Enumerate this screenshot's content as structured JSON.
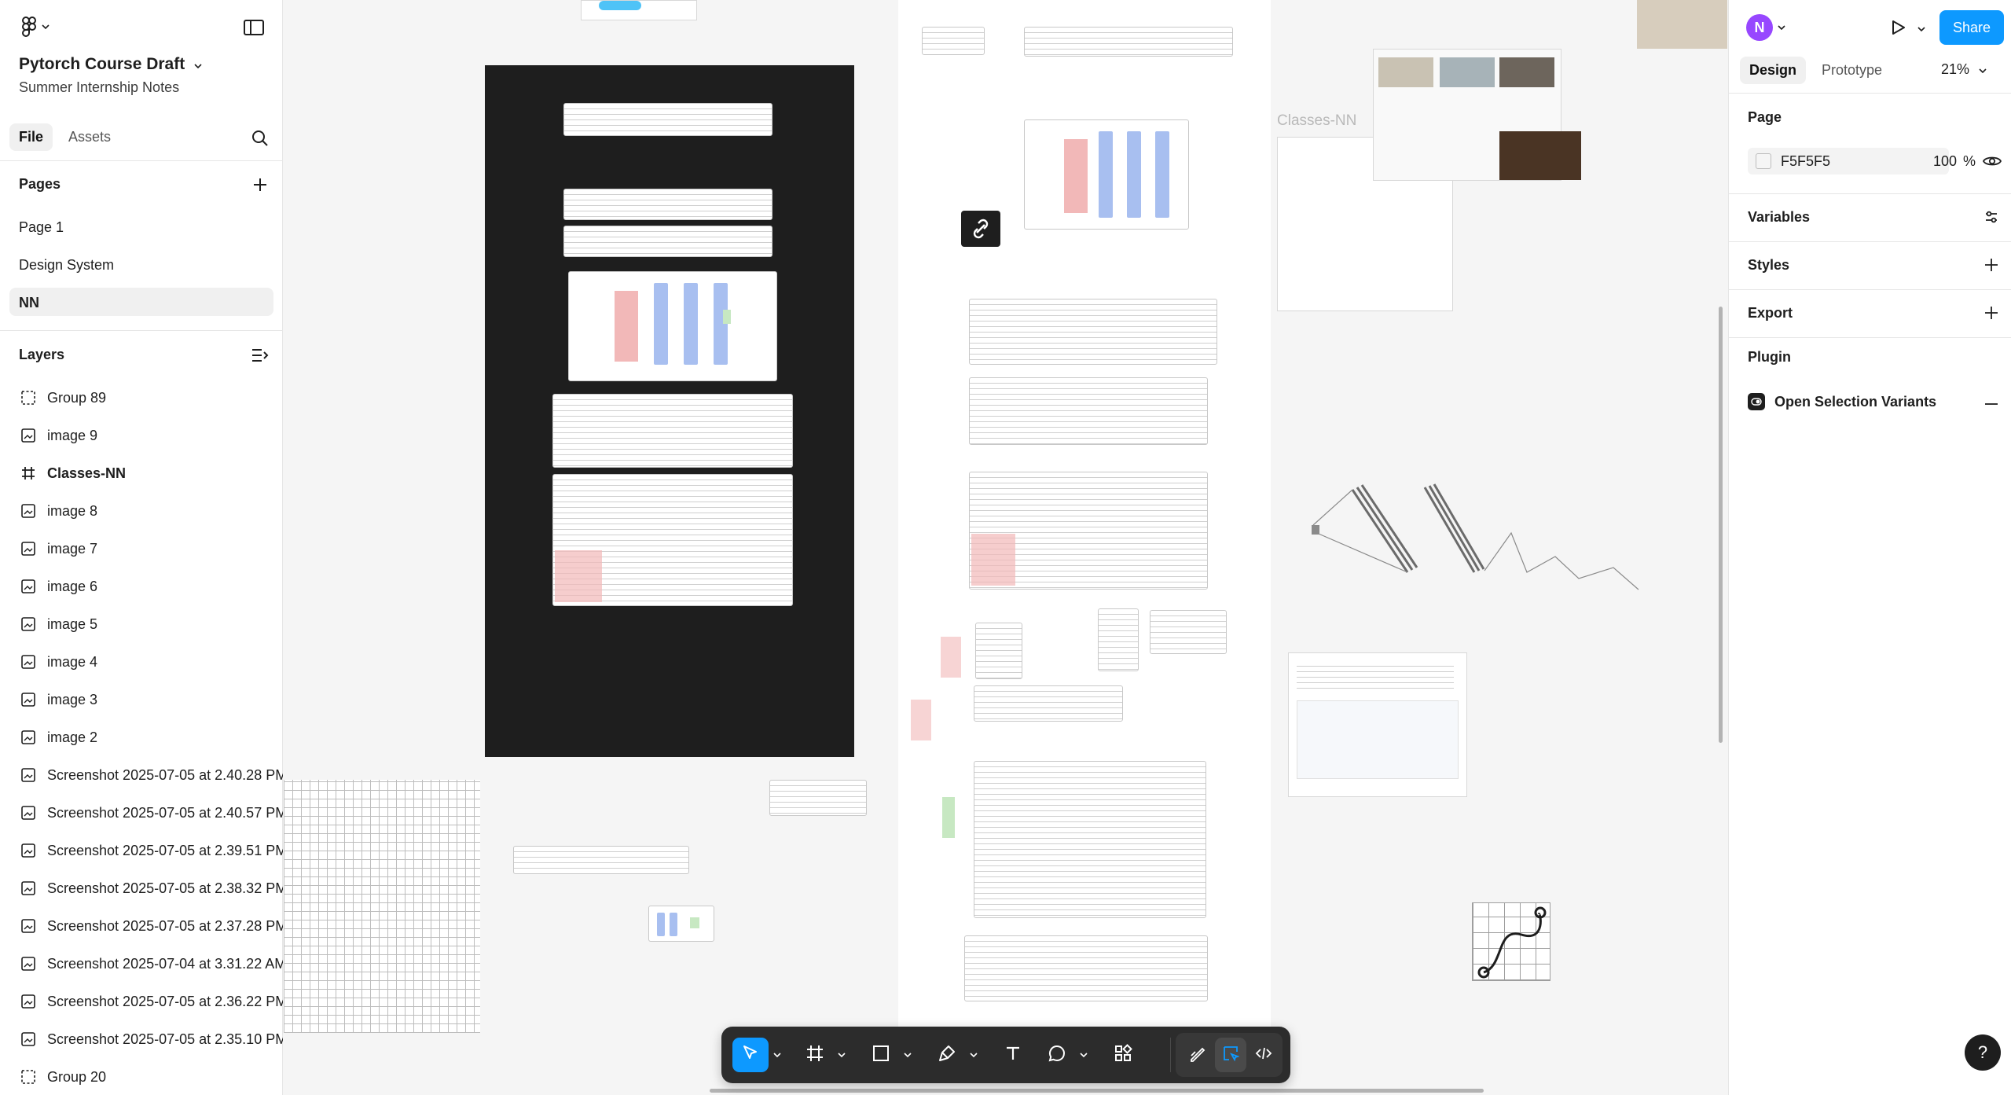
{
  "app": {
    "file_title": "Pytorch Course Draft",
    "file_subtitle": "Summer Internship Notes"
  },
  "left_panel": {
    "tabs": [
      {
        "label": "File",
        "active": true
      },
      {
        "label": "Assets",
        "active": false
      }
    ],
    "pages_heading": "Pages",
    "pages": [
      {
        "label": "Page 1",
        "active": false
      },
      {
        "label": "Design System",
        "active": false
      },
      {
        "label": "NN",
        "active": true
      }
    ],
    "layers_heading": "Layers",
    "layers": [
      {
        "label": "Group 89",
        "icon": "group-icon"
      },
      {
        "label": "image 9",
        "icon": "image-icon"
      },
      {
        "label": "Classes-NN",
        "icon": "frame-icon"
      },
      {
        "label": "image 8",
        "icon": "image-icon"
      },
      {
        "label": "image 7",
        "icon": "image-icon"
      },
      {
        "label": "image 6",
        "icon": "image-icon"
      },
      {
        "label": "image 5",
        "icon": "image-icon"
      },
      {
        "label": "image 4",
        "icon": "image-icon"
      },
      {
        "label": "image 3",
        "icon": "image-icon"
      },
      {
        "label": "image 2",
        "icon": "image-icon"
      },
      {
        "label": "Screenshot 2025-07-05 at 2.40.28 PM",
        "icon": "image-icon"
      },
      {
        "label": "Screenshot 2025-07-05 at 2.40.57 PM",
        "icon": "image-icon"
      },
      {
        "label": "Screenshot 2025-07-05 at 2.39.51 PM",
        "icon": "image-icon"
      },
      {
        "label": "Screenshot 2025-07-05 at 2.38.32 PM",
        "icon": "image-icon"
      },
      {
        "label": "Screenshot 2025-07-05 at 2.37.28 PM",
        "icon": "image-icon"
      },
      {
        "label": "Screenshot 2025-07-04 at 3.31.22 AM",
        "icon": "image-icon"
      },
      {
        "label": "Screenshot 2025-07-05 at 2.36.22 PM",
        "icon": "image-icon"
      },
      {
        "label": "Screenshot 2025-07-05 at 2.35.10 PM",
        "icon": "image-icon"
      },
      {
        "label": "Group 20",
        "icon": "group-icon"
      }
    ]
  },
  "canvas": {
    "frame_label": "Classes-NN",
    "background": "#F5F5F5"
  },
  "right_panel": {
    "avatar_initial": "N",
    "share_label": "Share",
    "tabs": [
      {
        "label": "Design",
        "active": true
      },
      {
        "label": "Prototype",
        "active": false
      }
    ],
    "zoom": "21%",
    "page_section": "Page",
    "page_color": "F5F5F5",
    "page_opacity": "100",
    "opacity_unit": "%",
    "variables_label": "Variables",
    "styles_label": "Styles",
    "export_label": "Export",
    "plugin_label": "Plugin",
    "plugin_item": "Open Selection Variants",
    "help_label": "?"
  },
  "colors": {
    "accent": "#0D99FF",
    "avatar": "#9747FF",
    "toolbar": "#2C2C2C",
    "dark_frame": "#1E1E1E"
  }
}
